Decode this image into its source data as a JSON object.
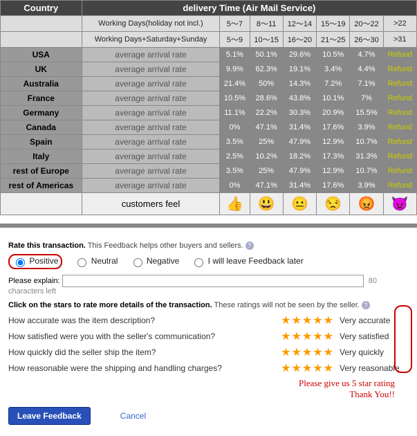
{
  "headers": {
    "country": "Country",
    "delivery": "delivery Time (Air Mail Service)",
    "working_days": "Working Days(holiday not incl.)",
    "working_sat": "Working Days+Saturday+Sunday"
  },
  "ranges1": [
    "5〜7",
    "8〜11",
    "12〜14",
    "15〜19",
    "20〜22",
    ">22"
  ],
  "ranges2": [
    "5〜9",
    "10〜15",
    "16〜20",
    "21〜25",
    "26〜30",
    ">31"
  ],
  "rate_label": "average arrival rate",
  "refund": "Refund",
  "rows": [
    {
      "country": "USA",
      "data": [
        "5.1%",
        "50.1%",
        "29.6%",
        "10.5%",
        "4.7%"
      ]
    },
    {
      "country": "UK",
      "data": [
        "9.9%",
        "62.3%",
        "19.1%",
        "3.4%",
        "4.4%"
      ]
    },
    {
      "country": "Australia",
      "data": [
        "21.4%",
        "50%",
        "14.3%",
        "7.2%",
        "7.1%"
      ]
    },
    {
      "country": "France",
      "data": [
        "10.5%",
        "28.6%",
        "43.8%",
        "10.1%",
        "7%"
      ]
    },
    {
      "country": "Germany",
      "data": [
        "11.1%",
        "22.2%",
        "30.3%",
        "20.9%",
        "15.5%"
      ]
    },
    {
      "country": "Canada",
      "data": [
        "0%",
        "47.1%",
        "31.4%",
        "17.6%",
        "3.9%"
      ]
    },
    {
      "country": "Spain",
      "data": [
        "3.5%",
        "25%",
        "47.9%",
        "12.9%",
        "10.7%"
      ]
    },
    {
      "country": "Italy",
      "data": [
        "2.5%",
        "10.2%",
        "18.2%",
        "17.3%",
        "31.3%"
      ]
    },
    {
      "country": "rest of Europe",
      "data": [
        "3.5%",
        "25%",
        "47.9%",
        "12.9%",
        "10.7%"
      ]
    },
    {
      "country": "rest of Americas",
      "data": [
        "0%",
        "47.1%",
        "31.4%",
        "17.6%",
        "3.9%"
      ]
    }
  ],
  "feel": "customers feel",
  "emojis": [
    "👍",
    "😃",
    "😐",
    "😒",
    "😡",
    "👿"
  ],
  "rate_title_bold": "Rate this transaction.",
  "rate_title_rest": " This Feedback helps other buyers and sellers. ",
  "radios": {
    "positive": "Positive",
    "neutral": "Neutral",
    "negative": "Negative",
    "later": "I will leave Feedback later"
  },
  "explain": "Please explain:",
  "chars": "80 characters left",
  "stars_title_bold": "Click on the stars to rate more details of the transaction.",
  "stars_title_rest": " These ratings will not be seen by the seller. ",
  "questions": [
    {
      "q": "How accurate was the item description?",
      "label": "Very accurate"
    },
    {
      "q": "How satisfied were you with the seller's communication?",
      "label": "Very satisfied"
    },
    {
      "q": "How quickly did the seller ship the item?",
      "label": "Very quickly"
    },
    {
      "q": "How reasonable were the shipping and handling charges?",
      "label": "Very reasonable"
    }
  ],
  "please1": "Please give us 5 star rating",
  "please2": "Thank You!!",
  "leave": "Leave Feedback",
  "cancel": "Cancel"
}
